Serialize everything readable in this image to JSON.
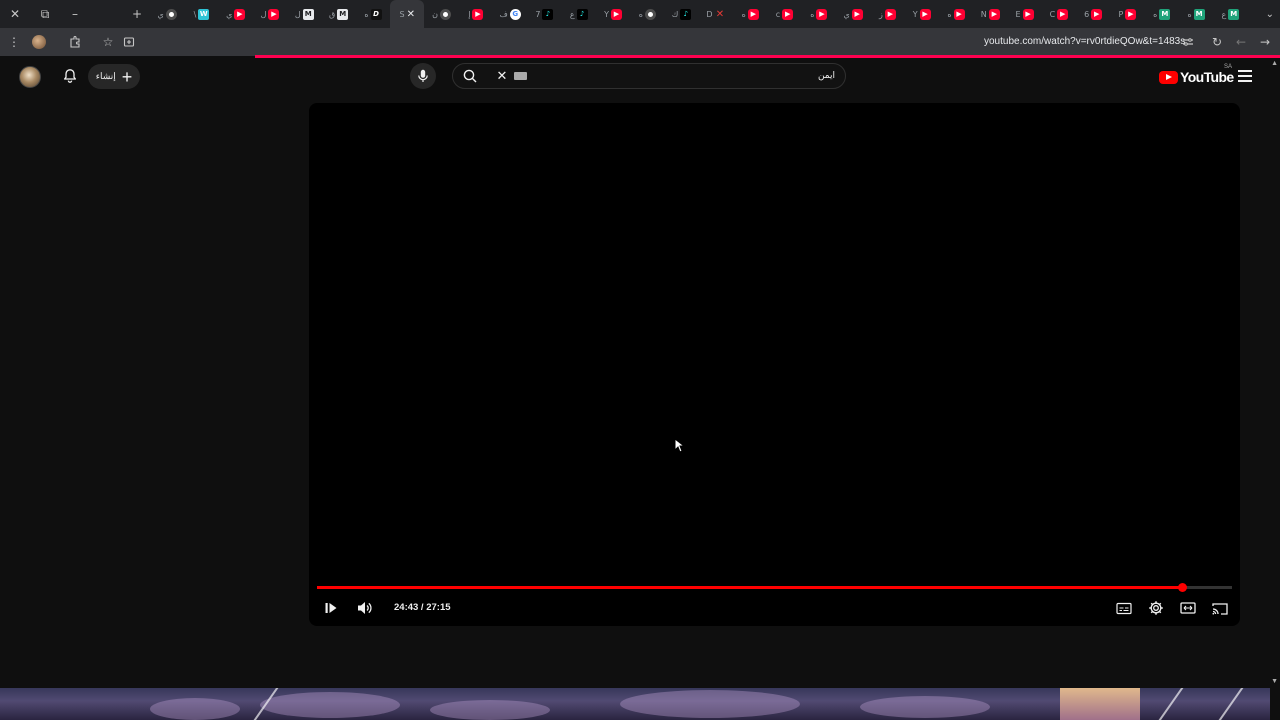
{
  "browser": {
    "window_controls": {
      "close": "✕",
      "restore": "⧉",
      "minimize": "–",
      "new_tab": "+"
    },
    "tabs": [
      {
        "letter": "ي",
        "icon": "chrome"
      },
      {
        "letter": "\\",
        "icon": "w"
      },
      {
        "letter": "ي",
        "icon": "yt"
      },
      {
        "letter": "ل",
        "icon": "yt"
      },
      {
        "letter": "ل",
        "icon": "book"
      },
      {
        "letter": "ق",
        "icon": "book"
      },
      {
        "letter": "ه",
        "icon": "d"
      },
      {
        "letter": "S",
        "icon": "close",
        "active": true
      },
      {
        "letter": "ن",
        "icon": "chrome"
      },
      {
        "letter": "إ",
        "icon": "yt"
      },
      {
        "letter": "ف",
        "icon": "g"
      },
      {
        "letter": "7",
        "icon": "tiktok"
      },
      {
        "letter": "ع",
        "icon": "tiktok"
      },
      {
        "letter": "Y",
        "icon": "yt"
      },
      {
        "letter": "ه",
        "icon": "chrome"
      },
      {
        "letter": "ك",
        "icon": "tiktok"
      },
      {
        "letter": "D",
        "icon": "x"
      },
      {
        "letter": "ه",
        "icon": "yt"
      },
      {
        "letter": "c",
        "icon": "yt"
      },
      {
        "letter": "ه",
        "icon": "yt"
      },
      {
        "letter": "ي",
        "icon": "yt"
      },
      {
        "letter": "ز",
        "icon": "yt"
      },
      {
        "letter": "Y",
        "icon": "yt"
      },
      {
        "letter": "ه",
        "icon": "yt"
      },
      {
        "letter": "N",
        "icon": "yt"
      },
      {
        "letter": "E",
        "icon": "yt"
      },
      {
        "letter": "C",
        "icon": "yt"
      },
      {
        "letter": "6",
        "icon": "yt"
      },
      {
        "letter": "P",
        "icon": "yt"
      },
      {
        "letter": "ه",
        "icon": "m"
      },
      {
        "letter": "ه",
        "icon": "m"
      },
      {
        "letter": "ع",
        "icon": "m"
      }
    ],
    "url": "youtube.com/watch?v=rv0rtdieQOw&t=1483s"
  },
  "header": {
    "create_label": "إنشاء",
    "search_value": "ايمن",
    "logo_text": "YouTube",
    "country_code": "SA"
  },
  "player": {
    "current_time": "24:43",
    "separator": " / ",
    "duration": "27:15",
    "time_text": "24:43 / 27:15",
    "progress_fraction": 0.945
  },
  "colors": {
    "accent": "#ff0000",
    "page_bg": "#0f0f0f",
    "loadbar": "#ff0050"
  }
}
